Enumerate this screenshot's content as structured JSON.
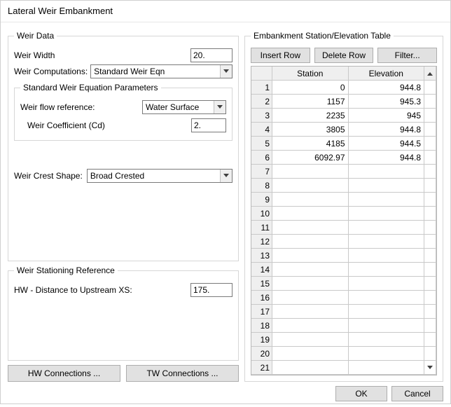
{
  "window": {
    "title": "Lateral Weir Embankment"
  },
  "weir_data": {
    "legend": "Weir Data",
    "width_label": "Weir Width",
    "width_value": "20.",
    "computations_label": "Weir Computations:",
    "computations_value": "Standard Weir Eqn",
    "std_legend": "Standard Weir Equation Parameters",
    "flow_ref_label": "Weir flow reference:",
    "flow_ref_value": "Water Surface",
    "cd_label": "Weir Coefficient (Cd)",
    "cd_value": "2.",
    "crest_label": "Weir Crest Shape:",
    "crest_value": "Broad Crested"
  },
  "stationing": {
    "legend": "Weir Stationing Reference",
    "hw_label": "HW - Distance to Upstream XS:",
    "hw_value": "175."
  },
  "left_buttons": {
    "hw_conn": "HW Connections ...",
    "tw_conn": "TW Connections ..."
  },
  "table": {
    "legend": "Embankment Station/Elevation Table",
    "insert": "Insert Row",
    "delete": "Delete Row",
    "filter": "Filter...",
    "col_station": "Station",
    "col_elevation": "Elevation",
    "rows": [
      {
        "n": "1",
        "station": "0",
        "elev": "944.8"
      },
      {
        "n": "2",
        "station": "1157",
        "elev": "945.3"
      },
      {
        "n": "3",
        "station": "2235",
        "elev": "945"
      },
      {
        "n": "4",
        "station": "3805",
        "elev": "944.8"
      },
      {
        "n": "5",
        "station": "4185",
        "elev": "944.5"
      },
      {
        "n": "6",
        "station": "6092.97",
        "elev": "944.8"
      },
      {
        "n": "7",
        "station": "",
        "elev": ""
      },
      {
        "n": "8",
        "station": "",
        "elev": ""
      },
      {
        "n": "9",
        "station": "",
        "elev": ""
      },
      {
        "n": "10",
        "station": "",
        "elev": ""
      },
      {
        "n": "11",
        "station": "",
        "elev": ""
      },
      {
        "n": "12",
        "station": "",
        "elev": ""
      },
      {
        "n": "13",
        "station": "",
        "elev": ""
      },
      {
        "n": "14",
        "station": "",
        "elev": ""
      },
      {
        "n": "15",
        "station": "",
        "elev": ""
      },
      {
        "n": "16",
        "station": "",
        "elev": ""
      },
      {
        "n": "17",
        "station": "",
        "elev": ""
      },
      {
        "n": "18",
        "station": "",
        "elev": ""
      },
      {
        "n": "19",
        "station": "",
        "elev": ""
      },
      {
        "n": "20",
        "station": "",
        "elev": ""
      },
      {
        "n": "21",
        "station": "",
        "elev": ""
      }
    ]
  },
  "footer": {
    "ok": "OK",
    "cancel": "Cancel"
  }
}
